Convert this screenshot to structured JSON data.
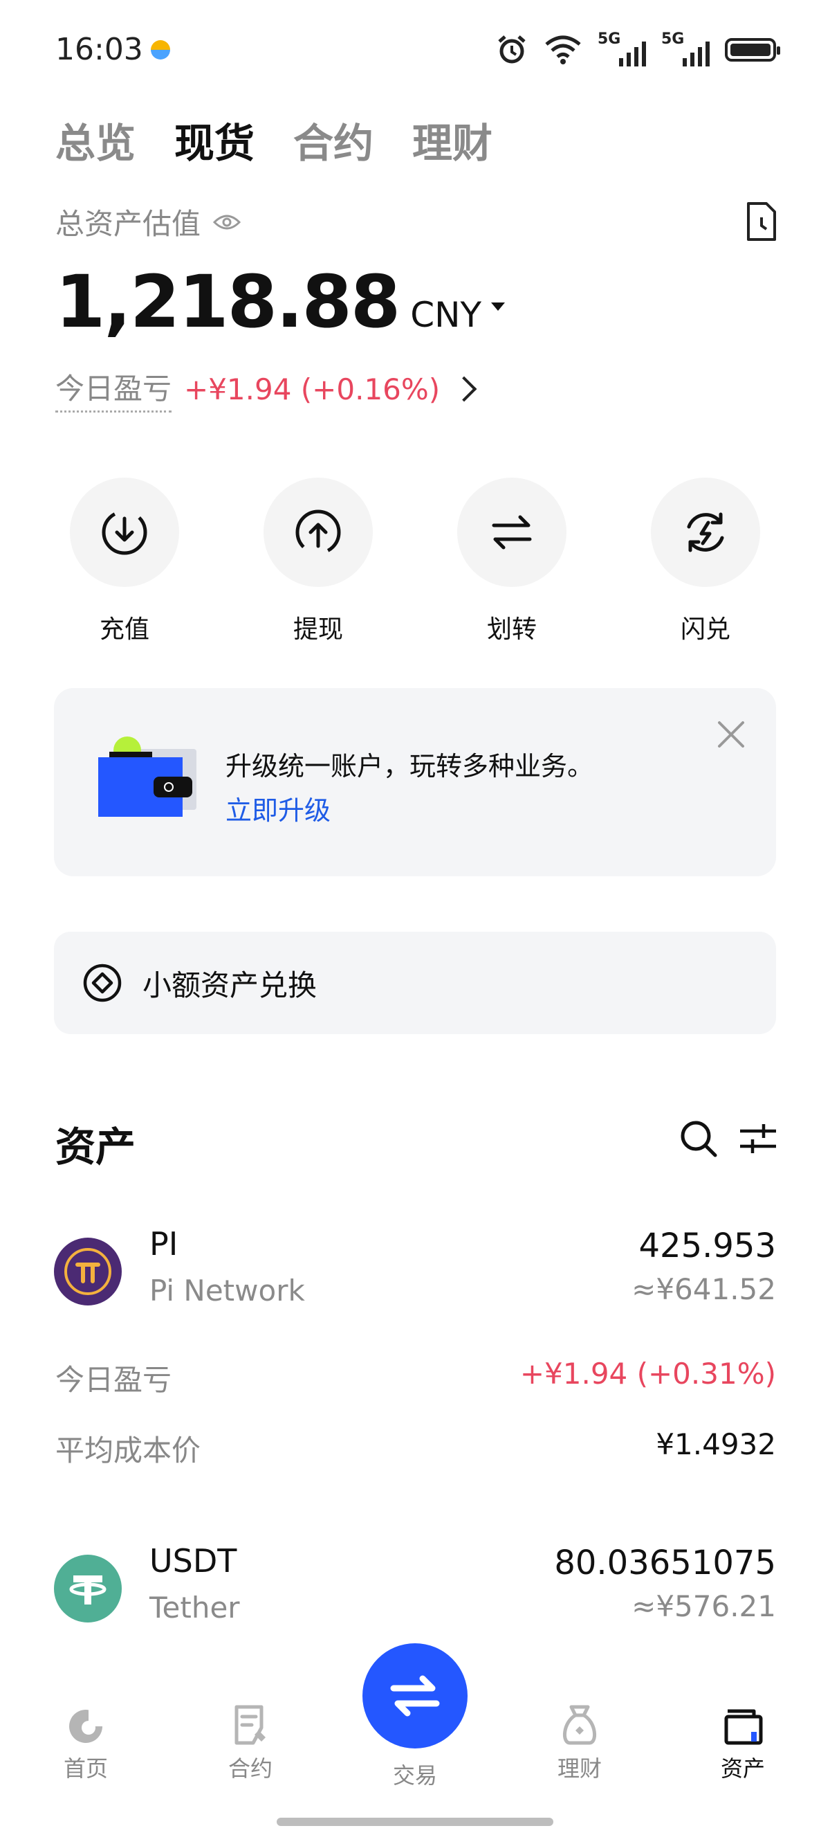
{
  "status_bar": {
    "time": "16:03",
    "network_1": "5G",
    "network_2": "5G",
    "icons": [
      "alarm-icon",
      "wifi-icon",
      "signal-icon",
      "signal-icon",
      "battery-icon"
    ]
  },
  "tabs": [
    {
      "label": "总览",
      "active": false
    },
    {
      "label": "现货",
      "active": true
    },
    {
      "label": "合约",
      "active": false
    },
    {
      "label": "理财",
      "active": false
    }
  ],
  "summary": {
    "label": "总资产估值",
    "value": "1,218.88",
    "currency": "CNY",
    "pnl_label": "今日盈亏",
    "pnl_value": "+¥1.94 (+0.16%)"
  },
  "actions": [
    {
      "label": "充值",
      "icon": "deposit-icon"
    },
    {
      "label": "提现",
      "icon": "withdraw-icon"
    },
    {
      "label": "划转",
      "icon": "transfer-icon"
    },
    {
      "label": "闪兑",
      "icon": "flash-convert-icon"
    }
  ],
  "banner": {
    "text": "升级统一账户，玩转多种业务。",
    "link": "立即升级"
  },
  "dust": {
    "label": "小额资产兑换"
  },
  "assets_section": {
    "title": "资产",
    "coins": [
      {
        "symbol": "PI",
        "name": "Pi Network",
        "quantity": "425.953",
        "fiat": "≈¥641.52",
        "pnl_label": "今日盈亏",
        "pnl_value": "+¥1.94 (+0.31%)",
        "cost_label": "平均成本价",
        "cost_value": "¥1.4932",
        "logo_color": "#4b2a73"
      },
      {
        "symbol": "USDT",
        "name": "Tether",
        "quantity": "80.03651075",
        "fiat": "≈¥576.21",
        "logo_color": "#50af95"
      }
    ]
  },
  "bottom_nav": [
    {
      "label": "首页",
      "icon": "home-icon",
      "active": false
    },
    {
      "label": "合约",
      "icon": "contract-icon",
      "active": false
    },
    {
      "label": "交易",
      "icon": "trade-icon",
      "active": false
    },
    {
      "label": "理财",
      "icon": "earn-icon",
      "active": false
    },
    {
      "label": "资产",
      "icon": "wallet-icon",
      "active": true
    }
  ],
  "colors": {
    "accent": "#2457ff",
    "link": "#1f5ce6",
    "profit": "#e8465e"
  }
}
